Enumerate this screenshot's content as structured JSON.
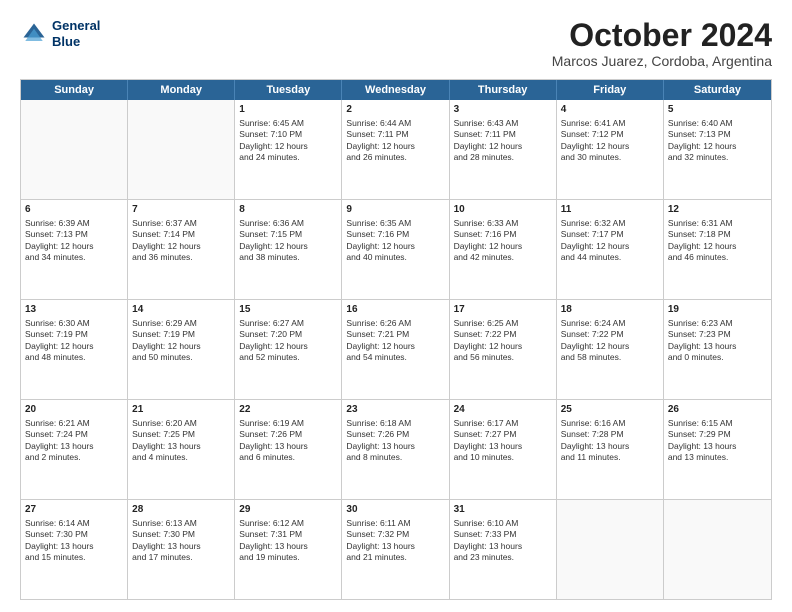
{
  "header": {
    "logo_line1": "General",
    "logo_line2": "Blue",
    "title": "October 2024",
    "subtitle": "Marcos Juarez, Cordoba, Argentina"
  },
  "calendar": {
    "days_of_week": [
      "Sunday",
      "Monday",
      "Tuesday",
      "Wednesday",
      "Thursday",
      "Friday",
      "Saturday"
    ],
    "weeks": [
      [
        {
          "day": "",
          "content": ""
        },
        {
          "day": "",
          "content": ""
        },
        {
          "day": "1",
          "content": "Sunrise: 6:45 AM\nSunset: 7:10 PM\nDaylight: 12 hours\nand 24 minutes."
        },
        {
          "day": "2",
          "content": "Sunrise: 6:44 AM\nSunset: 7:11 PM\nDaylight: 12 hours\nand 26 minutes."
        },
        {
          "day": "3",
          "content": "Sunrise: 6:43 AM\nSunset: 7:11 PM\nDaylight: 12 hours\nand 28 minutes."
        },
        {
          "day": "4",
          "content": "Sunrise: 6:41 AM\nSunset: 7:12 PM\nDaylight: 12 hours\nand 30 minutes."
        },
        {
          "day": "5",
          "content": "Sunrise: 6:40 AM\nSunset: 7:13 PM\nDaylight: 12 hours\nand 32 minutes."
        }
      ],
      [
        {
          "day": "6",
          "content": "Sunrise: 6:39 AM\nSunset: 7:13 PM\nDaylight: 12 hours\nand 34 minutes."
        },
        {
          "day": "7",
          "content": "Sunrise: 6:37 AM\nSunset: 7:14 PM\nDaylight: 12 hours\nand 36 minutes."
        },
        {
          "day": "8",
          "content": "Sunrise: 6:36 AM\nSunset: 7:15 PM\nDaylight: 12 hours\nand 38 minutes."
        },
        {
          "day": "9",
          "content": "Sunrise: 6:35 AM\nSunset: 7:16 PM\nDaylight: 12 hours\nand 40 minutes."
        },
        {
          "day": "10",
          "content": "Sunrise: 6:33 AM\nSunset: 7:16 PM\nDaylight: 12 hours\nand 42 minutes."
        },
        {
          "day": "11",
          "content": "Sunrise: 6:32 AM\nSunset: 7:17 PM\nDaylight: 12 hours\nand 44 minutes."
        },
        {
          "day": "12",
          "content": "Sunrise: 6:31 AM\nSunset: 7:18 PM\nDaylight: 12 hours\nand 46 minutes."
        }
      ],
      [
        {
          "day": "13",
          "content": "Sunrise: 6:30 AM\nSunset: 7:19 PM\nDaylight: 12 hours\nand 48 minutes."
        },
        {
          "day": "14",
          "content": "Sunrise: 6:29 AM\nSunset: 7:19 PM\nDaylight: 12 hours\nand 50 minutes."
        },
        {
          "day": "15",
          "content": "Sunrise: 6:27 AM\nSunset: 7:20 PM\nDaylight: 12 hours\nand 52 minutes."
        },
        {
          "day": "16",
          "content": "Sunrise: 6:26 AM\nSunset: 7:21 PM\nDaylight: 12 hours\nand 54 minutes."
        },
        {
          "day": "17",
          "content": "Sunrise: 6:25 AM\nSunset: 7:22 PM\nDaylight: 12 hours\nand 56 minutes."
        },
        {
          "day": "18",
          "content": "Sunrise: 6:24 AM\nSunset: 7:22 PM\nDaylight: 12 hours\nand 58 minutes."
        },
        {
          "day": "19",
          "content": "Sunrise: 6:23 AM\nSunset: 7:23 PM\nDaylight: 13 hours\nand 0 minutes."
        }
      ],
      [
        {
          "day": "20",
          "content": "Sunrise: 6:21 AM\nSunset: 7:24 PM\nDaylight: 13 hours\nand 2 minutes."
        },
        {
          "day": "21",
          "content": "Sunrise: 6:20 AM\nSunset: 7:25 PM\nDaylight: 13 hours\nand 4 minutes."
        },
        {
          "day": "22",
          "content": "Sunrise: 6:19 AM\nSunset: 7:26 PM\nDaylight: 13 hours\nand 6 minutes."
        },
        {
          "day": "23",
          "content": "Sunrise: 6:18 AM\nSunset: 7:26 PM\nDaylight: 13 hours\nand 8 minutes."
        },
        {
          "day": "24",
          "content": "Sunrise: 6:17 AM\nSunset: 7:27 PM\nDaylight: 13 hours\nand 10 minutes."
        },
        {
          "day": "25",
          "content": "Sunrise: 6:16 AM\nSunset: 7:28 PM\nDaylight: 13 hours\nand 11 minutes."
        },
        {
          "day": "26",
          "content": "Sunrise: 6:15 AM\nSunset: 7:29 PM\nDaylight: 13 hours\nand 13 minutes."
        }
      ],
      [
        {
          "day": "27",
          "content": "Sunrise: 6:14 AM\nSunset: 7:30 PM\nDaylight: 13 hours\nand 15 minutes."
        },
        {
          "day": "28",
          "content": "Sunrise: 6:13 AM\nSunset: 7:30 PM\nDaylight: 13 hours\nand 17 minutes."
        },
        {
          "day": "29",
          "content": "Sunrise: 6:12 AM\nSunset: 7:31 PM\nDaylight: 13 hours\nand 19 minutes."
        },
        {
          "day": "30",
          "content": "Sunrise: 6:11 AM\nSunset: 7:32 PM\nDaylight: 13 hours\nand 21 minutes."
        },
        {
          "day": "31",
          "content": "Sunrise: 6:10 AM\nSunset: 7:33 PM\nDaylight: 13 hours\nand 23 minutes."
        },
        {
          "day": "",
          "content": ""
        },
        {
          "day": "",
          "content": ""
        }
      ]
    ]
  }
}
